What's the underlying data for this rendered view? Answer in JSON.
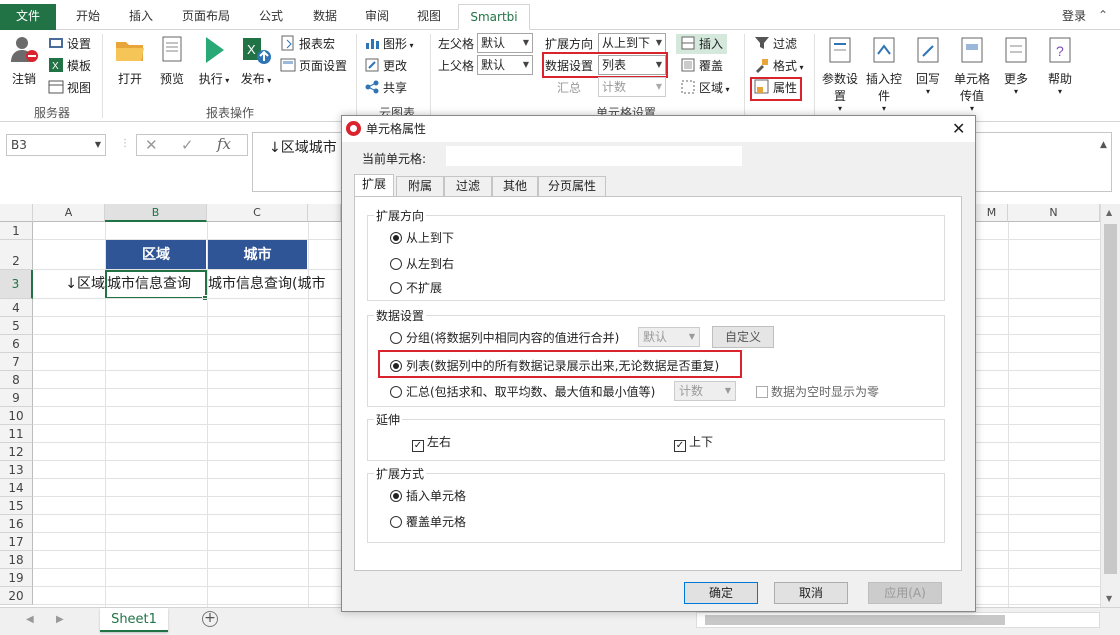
{
  "ribbon_tabs": [
    {
      "label": "文件"
    },
    {
      "label": "开始"
    },
    {
      "label": "插入"
    },
    {
      "label": "页面布局"
    },
    {
      "label": "公式"
    },
    {
      "label": "数据"
    },
    {
      "label": "审阅"
    },
    {
      "label": "视图"
    },
    {
      "label": "Smartbi"
    }
  ],
  "login": "登录",
  "groups": {
    "server": {
      "label": "服务器",
      "logout": "注销",
      "settings": "设置",
      "template": "模板",
      "view": "视图"
    },
    "report": {
      "label": "报表操作",
      "open": "打开",
      "preview": "预览",
      "run": "执行",
      "publish": "发布",
      "report_macro": "报表宏",
      "page_setup": "页面设置"
    },
    "cloud": {
      "label": "云图表",
      "shape": "图形",
      "change": "更改",
      "share": "共享"
    },
    "cell": {
      "label": "单元格设置",
      "left_parent": "左父格",
      "left_parent_value": "默认",
      "top_parent": "上父格",
      "top_parent_value": "默认",
      "expand_dir": "扩展方向",
      "expand_dir_value": "从上到下",
      "data_setting": "数据设置",
      "data_setting_value": "列表",
      "summary": "汇总",
      "summary_value": "计数",
      "insert": "插入",
      "cover": "覆盖",
      "area": "区域",
      "filter": "过滤",
      "format": "格式",
      "property": "属性"
    },
    "misc": {
      "param": "参数设置",
      "insert_ctrl": "插入控件",
      "writeback": "回写",
      "cell_pass": "单元格传值",
      "more": "更多",
      "help": "帮助"
    }
  },
  "name_box": "B3",
  "formula_text": "↓区域城市",
  "columns": [
    "A",
    "B",
    "C",
    "",
    "M",
    "N"
  ],
  "rows": [
    "1",
    "2",
    "3",
    "4",
    "5",
    "6",
    "7",
    "8",
    "9",
    "10",
    "11",
    "12",
    "13",
    "14",
    "15",
    "16",
    "17",
    "18",
    "19",
    "20"
  ],
  "cells": {
    "b2": "区域",
    "c2": "城市",
    "a3": "↓区域",
    "b3": "城市信息查询",
    "c3": "城市信息查询(城市"
  },
  "sheet_tab": "Sheet1",
  "dialog": {
    "title": "单元格属性",
    "current_cell_label": "当前单元格:",
    "current_cell_value": "",
    "tabs": [
      "扩展",
      "附属",
      "过滤",
      "其他",
      "分页属性"
    ],
    "expand_dir": {
      "legend": "扩展方向",
      "opts": [
        "从上到下",
        "从左到右",
        "不扩展"
      ]
    },
    "data_setting": {
      "legend": "数据设置",
      "group": "分组(将数据列中相同内容的值进行合并)",
      "group_select": "默认",
      "custom": "自定义",
      "list": "列表(数据列中的所有数据记录展示出来,无论数据是否重复)",
      "summary": "汇总(包括求和、取平均数、最大值和最小值等)",
      "summary_select": "计数",
      "zero": "数据为空时显示为零"
    },
    "extend": {
      "legend": "延伸",
      "lr": "左右",
      "ud": "上下"
    },
    "expand_mode": {
      "legend": "扩展方式",
      "insert": "插入单元格",
      "cover": "覆盖单元格"
    },
    "ok": "确定",
    "cancel": "取消",
    "apply": "应用(A)"
  }
}
